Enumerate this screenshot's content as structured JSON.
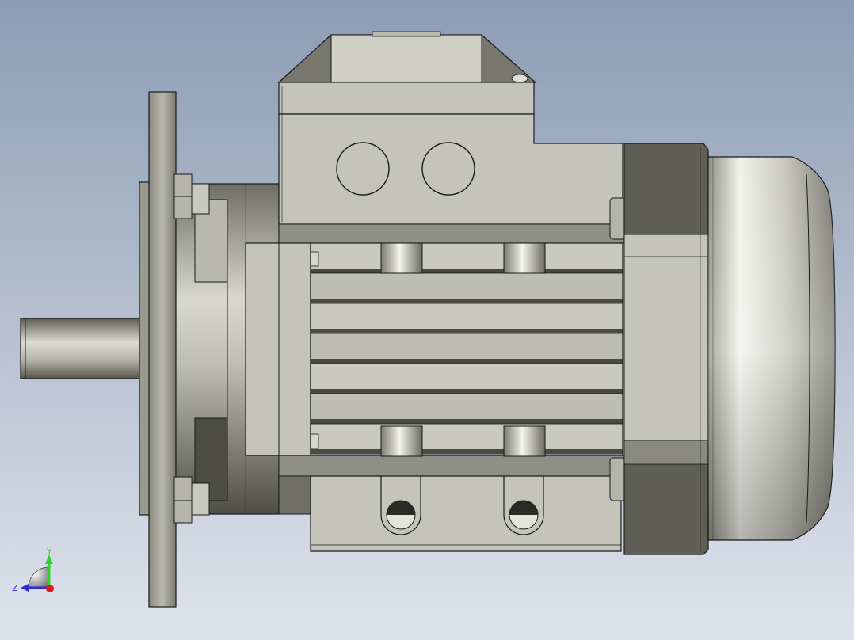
{
  "viewport": {
    "background_top": "#8c9cb4",
    "background_bottom": "#dfe3ec"
  },
  "colors": {
    "outline": "#1a1a1a",
    "metal_dark": "#5c5c52",
    "metal_mid": "#a7a79c",
    "metal_light": "#d8d8d0",
    "metal_hi": "#f0f0ea",
    "body_gray": "#c4c4bb",
    "side_gray": "#8a8a80"
  },
  "triad": {
    "y_label": "Y",
    "z_label": "Z",
    "y_color": "#2fd12f",
    "z_color": "#2b2bd8",
    "x_color": "#e01b1b"
  }
}
